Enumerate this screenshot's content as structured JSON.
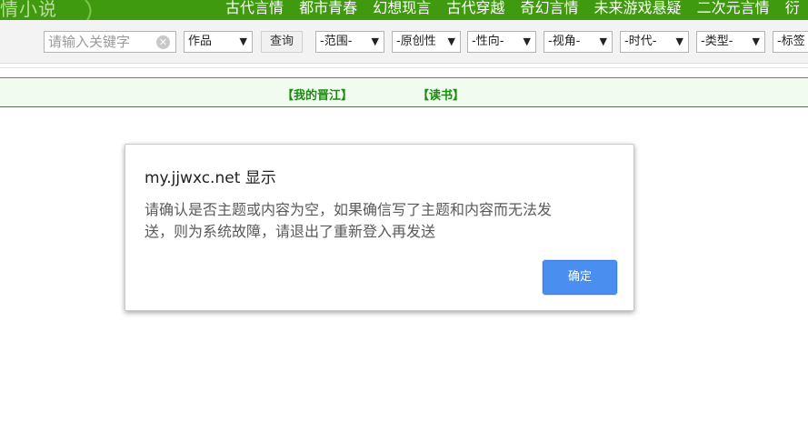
{
  "topnav": {
    "logo_fragment": "情小说",
    "links": [
      "古代言情",
      "都市青春",
      "幻想现言",
      "古代穿越",
      "奇幻言情",
      "未来游戏悬疑",
      "二次元言情",
      "衍"
    ]
  },
  "searchbar": {
    "search_placeholder": "请输入关键字",
    "type_select": "作品",
    "query_label": "查询",
    "filters": [
      "-范围-",
      "-原创性",
      "-性向-",
      "-视角-",
      "-时代-",
      "-类型-",
      "-标签"
    ]
  },
  "subnav": {
    "links": [
      "【我的晋江】",
      "【读书】"
    ]
  },
  "dialog": {
    "title": "my.jjwxc.net 显示",
    "message_line1": "请确认是否主题或内容为空，如果确信写了主题和内容而无法发",
    "message_line2": "送，则为系统故障，请退出了重新登入再发送",
    "ok_label": "确定"
  },
  "colors": {
    "nav_green": "#3f9a10",
    "link_green": "#1c8a12",
    "ok_blue": "#4a8ef0"
  }
}
